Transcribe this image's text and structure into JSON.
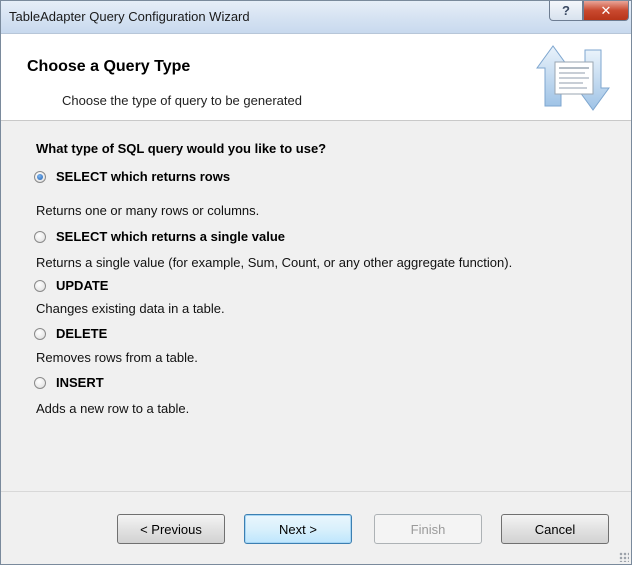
{
  "window": {
    "title": "TableAdapter Query Configuration Wizard",
    "help_label": "?",
    "close_label": "✕"
  },
  "header": {
    "title": "Choose a Query Type",
    "subtitle": "Choose the type of query to be generated",
    "icon": "query-wizard-icon"
  },
  "main": {
    "question": "What type of SQL query would you like to use?",
    "options": [
      {
        "label": "SELECT which returns rows",
        "description": "Returns one or many rows or columns.",
        "checked": true
      },
      {
        "label": "SELECT which returns a single value",
        "description": "Returns a single value (for example, Sum, Count, or any other aggregate function).",
        "checked": false
      },
      {
        "label": "UPDATE",
        "description": "Changes existing data in a table.",
        "checked": false
      },
      {
        "label": "DELETE",
        "description": "Removes rows from a table.",
        "checked": false
      },
      {
        "label": "INSERT",
        "description": "Adds a new row to a table.",
        "checked": false
      }
    ]
  },
  "footer": {
    "previous_label": "< Previous",
    "next_label": "Next >",
    "finish_label": "Finish",
    "cancel_label": "Cancel"
  }
}
